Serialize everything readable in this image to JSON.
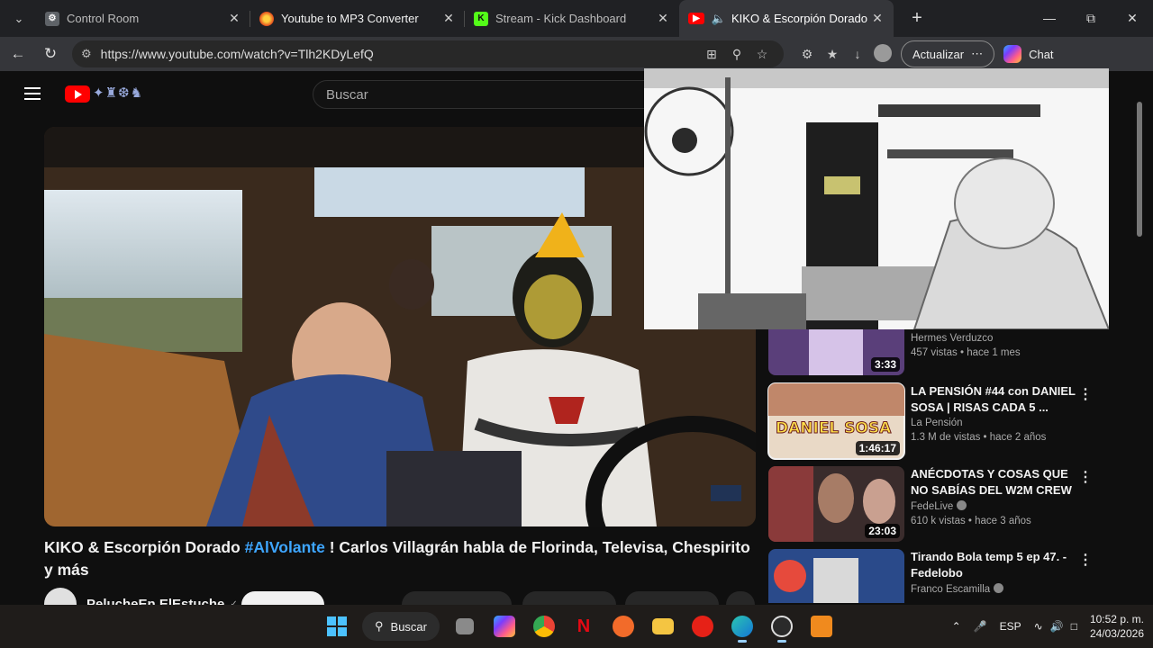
{
  "browser": {
    "tabs": [
      {
        "title": "Control Room",
        "favicon": "gear-icon",
        "active": false
      },
      {
        "title": "Youtube to MP3 Converter",
        "favicon": "orange-swirl-icon",
        "active": false
      },
      {
        "title": "Stream - Kick Dashboard",
        "favicon": "kick-icon",
        "active": false
      },
      {
        "title": "KIKO & Escorpión Dorado #Al",
        "favicon": "youtube-icon",
        "active": true
      }
    ],
    "url": "https://www.youtube.com/watch?v=Tlh2KDyLefQ",
    "update_label": "Actualizar",
    "chat_label": "Chat"
  },
  "youtube": {
    "search_placeholder": "Buscar",
    "video": {
      "title": "KIKO & Escorpión Dorado",
      "hashtag": "#AlVolante",
      "title_rest": "! Carlos Villagrán habla de Florinda, Televisa, Chespirito y más",
      "channel": "PelucheEn ElEstuche"
    },
    "recommendations": [
      {
        "title": "",
        "channel": "Hermes Verduzco",
        "views": "457 vistas • hace 1 mes",
        "duration": "3:33"
      },
      {
        "title": "LA PENSIÓN #44 con DANIEL SOSA | RISAS CADA 5 ...",
        "channel": "La Pensión",
        "views": "1.3 M de vistas • hace 2 años",
        "duration": "1:46:17",
        "thumb_text": "DANIEL SOSA"
      },
      {
        "title": "ANÉCDOTAS Y COSAS QUE NO SABÍAS DEL W2M CREW",
        "channel": "FedeLive",
        "views": "610 k vistas • hace 3 años",
        "duration": "23:03"
      },
      {
        "title": "Tirando Bola temp 5 ep 47. - Fedelobo",
        "channel": "Franco Escamilla",
        "views": "",
        "duration": ""
      }
    ]
  },
  "taskbar": {
    "search_label": "Buscar",
    "language": "ESP",
    "time": "10:52 p. m.",
    "date": "24/03/2026"
  }
}
